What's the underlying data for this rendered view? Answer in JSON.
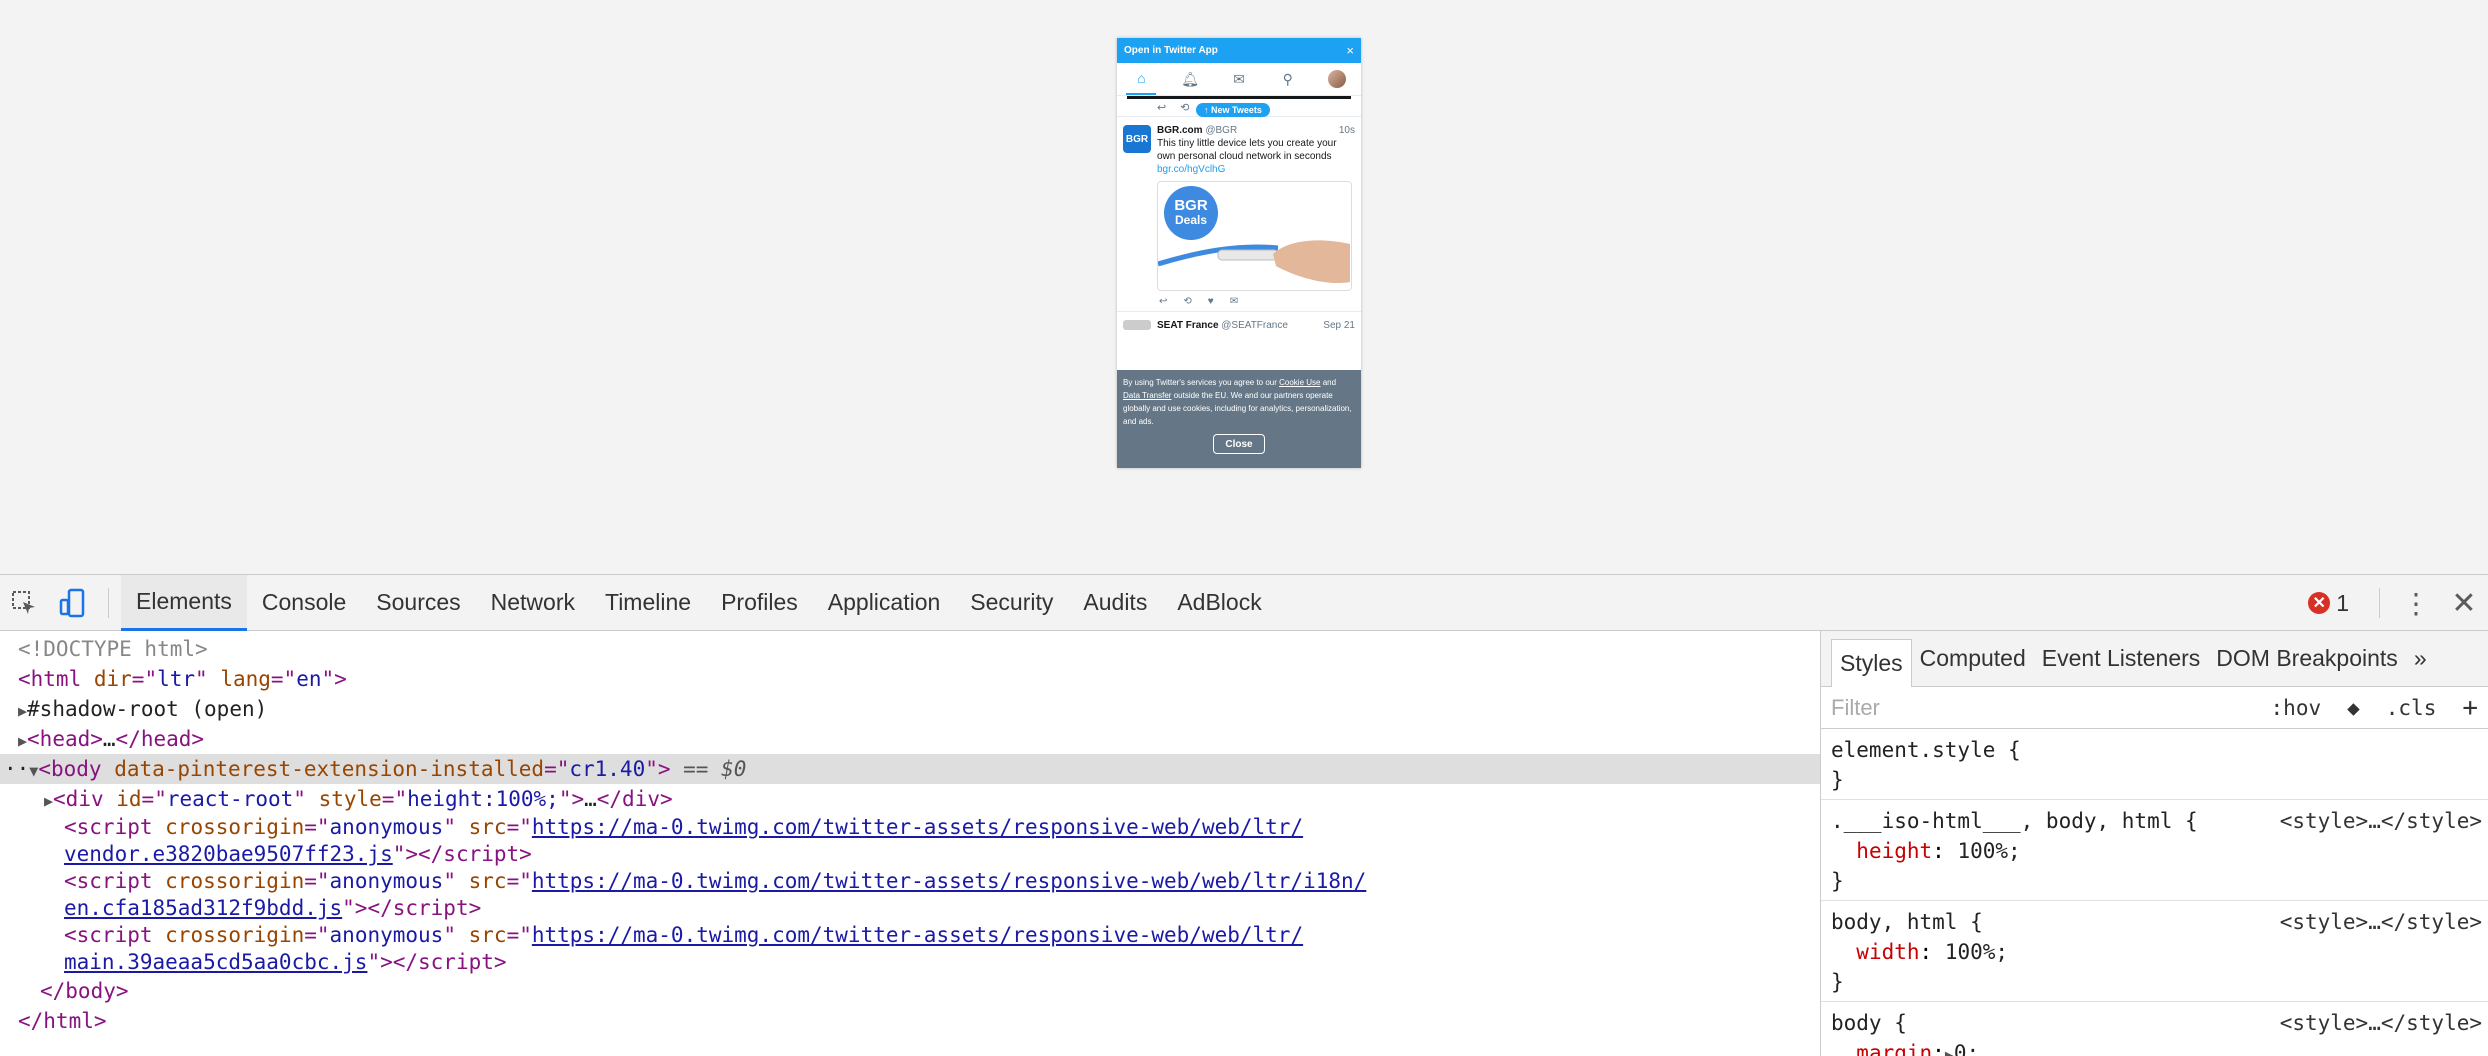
{
  "twitter": {
    "banner_text": "Open in Twitter App",
    "banner_close": "×",
    "new_tweets": "↑ New Tweets",
    "tweet1": {
      "avatar": "BGR",
      "name": "BGR.com",
      "handle": "@BGR",
      "time": "10s",
      "text": "This tiny little device lets you create your own personal cloud network in seconds",
      "link": "bgr.co/hgVclhG",
      "media_badge_line1": "BGR",
      "media_badge_line2": "Deals"
    },
    "tweet2": {
      "name": "SEAT France",
      "handle": "@SEATFrance",
      "time": "Sep 21"
    },
    "cookie_text_1": "By using Twitter's services you agree to our ",
    "cookie_link_1": "Cookie Use",
    "cookie_text_2": " and ",
    "cookie_link_2": "Data Transfer",
    "cookie_text_3": " outside the EU. We and our partners operate globally and use cookies, including for analytics, personalization, and ads.",
    "cookie_close": "Close"
  },
  "devtools": {
    "tabs": [
      "Elements",
      "Console",
      "Sources",
      "Network",
      "Timeline",
      "Profiles",
      "Application",
      "Security",
      "Audits",
      "AdBlock"
    ],
    "error_count": "1",
    "styles_tabs": [
      "Styles",
      "Computed",
      "Event Listeners",
      "DOM Breakpoints"
    ],
    "filter_placeholder": "Filter",
    "hov": ":hov",
    "cls": ".cls",
    "dom": {
      "doctype": "<!DOCTYPE html>",
      "shadow_root": "#shadow-root (open)",
      "body_attr": "data-pinterest-extension-installed",
      "body_val": "cr1.40",
      "selected_marker": " == $0",
      "url1a": "https://ma-0.twimg.com/twitter-assets/responsive-web/web/ltr/",
      "url1b": "vendor.e3820bae9507ff23.js",
      "url2a": "https://ma-0.twimg.com/twitter-assets/responsive-web/web/ltr/i18n/",
      "url2b": "en.cfa185ad312f9bdd.js",
      "url3a": "https://ma-0.twimg.com/twitter-assets/responsive-web/web/ltr/",
      "url3b": "main.39aeaa5cd5aa0cbc.js"
    },
    "styles": {
      "rule1_selector": "element.style {",
      "rule2_selector": ".___iso-html___, body, html {",
      "rule2_prop": "height",
      "rule2_val": "100%;",
      "rule3_selector": "body, html {",
      "rule3_prop": "width",
      "rule3_val": "100%;",
      "rule4_selector": "body {",
      "rule4_prop": "margin",
      "rule4_val": "0;",
      "source": "<style>…</style>"
    }
  }
}
